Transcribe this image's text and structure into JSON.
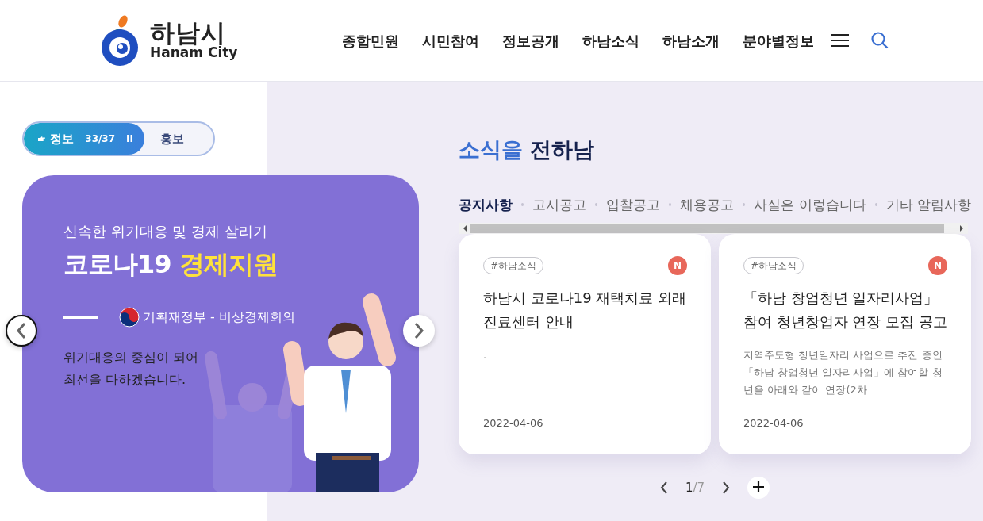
{
  "header": {
    "logo": {
      "name_ko": "하남시",
      "name_en": "Hanam City"
    },
    "nav": [
      {
        "label": "종합민원"
      },
      {
        "label": "시민참여"
      },
      {
        "label": "정보공개"
      },
      {
        "label": "하남소식"
      },
      {
        "label": "하남소개"
      },
      {
        "label": "분야별정보"
      }
    ]
  },
  "promo_tabs": [
    {
      "label": "정보",
      "selected": true,
      "counter": "33/37",
      "pause": "II"
    },
    {
      "label": "홍보",
      "selected": false
    }
  ],
  "banner": {
    "subtitle": "신속한 위기대응 및 경제 살리기",
    "title": "코로나19",
    "title_highlight": "경제지원",
    "source": "기획재정부 - 비상경제회의",
    "body_lines": [
      "위기대응의 중심이 되어",
      "최선을 다하겠습니다."
    ]
  },
  "news": {
    "heading": "소식을",
    "heading_strong": "전하남",
    "tabs": [
      {
        "label": "공지사항",
        "selected": true
      },
      {
        "label": "고시공고",
        "selected": false
      },
      {
        "label": "입찰공고",
        "selected": false
      },
      {
        "label": "채용공고",
        "selected": false
      },
      {
        "label": "사실은 이렇습니다",
        "selected": false
      },
      {
        "label": "기타 알림사항",
        "selected": false
      }
    ],
    "cards": [
      {
        "tag": "#하남소식",
        "badge": "N",
        "title": "하남시 코로나19 재택치료 외래 진료센터 안내",
        "summary": ".",
        "date": "2022-04-06"
      },
      {
        "tag": "#하남소식",
        "badge": "N",
        "title": "「하남 창업청년 일자리사업」 참여 청년창업자 연장 모집 공고",
        "summary": "지역주도형 청년일자리 사업으로 추진 중인 「하남 창업청년 일자리사업」에 참여할 청년을 아래와 같이 연장(2차",
        "date": "2022-04-06"
      }
    ],
    "pagination": {
      "current": "1",
      "total": "/7"
    }
  }
}
